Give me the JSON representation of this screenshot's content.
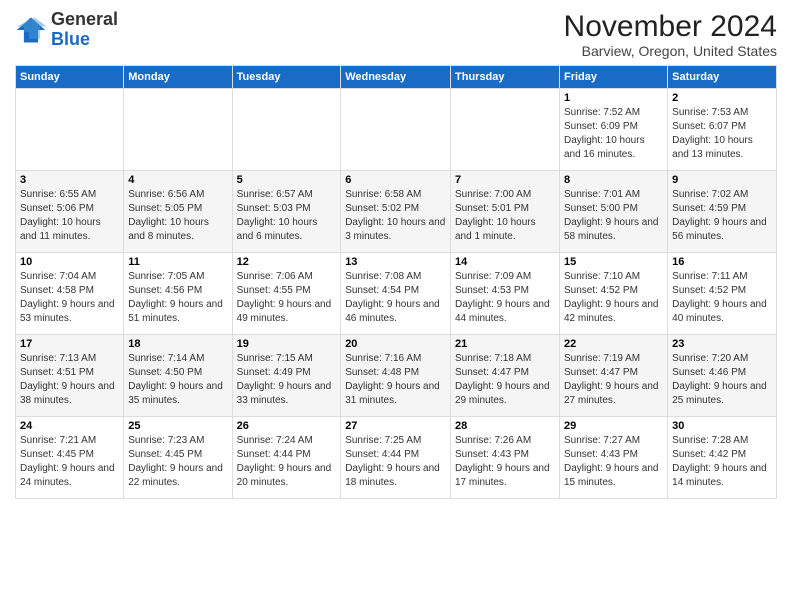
{
  "logo": {
    "general": "General",
    "blue": "Blue"
  },
  "title": "November 2024",
  "location": "Barview, Oregon, United States",
  "days_of_week": [
    "Sunday",
    "Monday",
    "Tuesday",
    "Wednesday",
    "Thursday",
    "Friday",
    "Saturday"
  ],
  "weeks": [
    [
      {
        "day": "",
        "info": ""
      },
      {
        "day": "",
        "info": ""
      },
      {
        "day": "",
        "info": ""
      },
      {
        "day": "",
        "info": ""
      },
      {
        "day": "",
        "info": ""
      },
      {
        "day": "1",
        "info": "Sunrise: 7:52 AM\nSunset: 6:09 PM\nDaylight: 10 hours and 16 minutes."
      },
      {
        "day": "2",
        "info": "Sunrise: 7:53 AM\nSunset: 6:07 PM\nDaylight: 10 hours and 13 minutes."
      }
    ],
    [
      {
        "day": "3",
        "info": "Sunrise: 6:55 AM\nSunset: 5:06 PM\nDaylight: 10 hours and 11 minutes."
      },
      {
        "day": "4",
        "info": "Sunrise: 6:56 AM\nSunset: 5:05 PM\nDaylight: 10 hours and 8 minutes."
      },
      {
        "day": "5",
        "info": "Sunrise: 6:57 AM\nSunset: 5:03 PM\nDaylight: 10 hours and 6 minutes."
      },
      {
        "day": "6",
        "info": "Sunrise: 6:58 AM\nSunset: 5:02 PM\nDaylight: 10 hours and 3 minutes."
      },
      {
        "day": "7",
        "info": "Sunrise: 7:00 AM\nSunset: 5:01 PM\nDaylight: 10 hours and 1 minute."
      },
      {
        "day": "8",
        "info": "Sunrise: 7:01 AM\nSunset: 5:00 PM\nDaylight: 9 hours and 58 minutes."
      },
      {
        "day": "9",
        "info": "Sunrise: 7:02 AM\nSunset: 4:59 PM\nDaylight: 9 hours and 56 minutes."
      }
    ],
    [
      {
        "day": "10",
        "info": "Sunrise: 7:04 AM\nSunset: 4:58 PM\nDaylight: 9 hours and 53 minutes."
      },
      {
        "day": "11",
        "info": "Sunrise: 7:05 AM\nSunset: 4:56 PM\nDaylight: 9 hours and 51 minutes."
      },
      {
        "day": "12",
        "info": "Sunrise: 7:06 AM\nSunset: 4:55 PM\nDaylight: 9 hours and 49 minutes."
      },
      {
        "day": "13",
        "info": "Sunrise: 7:08 AM\nSunset: 4:54 PM\nDaylight: 9 hours and 46 minutes."
      },
      {
        "day": "14",
        "info": "Sunrise: 7:09 AM\nSunset: 4:53 PM\nDaylight: 9 hours and 44 minutes."
      },
      {
        "day": "15",
        "info": "Sunrise: 7:10 AM\nSunset: 4:52 PM\nDaylight: 9 hours and 42 minutes."
      },
      {
        "day": "16",
        "info": "Sunrise: 7:11 AM\nSunset: 4:52 PM\nDaylight: 9 hours and 40 minutes."
      }
    ],
    [
      {
        "day": "17",
        "info": "Sunrise: 7:13 AM\nSunset: 4:51 PM\nDaylight: 9 hours and 38 minutes."
      },
      {
        "day": "18",
        "info": "Sunrise: 7:14 AM\nSunset: 4:50 PM\nDaylight: 9 hours and 35 minutes."
      },
      {
        "day": "19",
        "info": "Sunrise: 7:15 AM\nSunset: 4:49 PM\nDaylight: 9 hours and 33 minutes."
      },
      {
        "day": "20",
        "info": "Sunrise: 7:16 AM\nSunset: 4:48 PM\nDaylight: 9 hours and 31 minutes."
      },
      {
        "day": "21",
        "info": "Sunrise: 7:18 AM\nSunset: 4:47 PM\nDaylight: 9 hours and 29 minutes."
      },
      {
        "day": "22",
        "info": "Sunrise: 7:19 AM\nSunset: 4:47 PM\nDaylight: 9 hours and 27 minutes."
      },
      {
        "day": "23",
        "info": "Sunrise: 7:20 AM\nSunset: 4:46 PM\nDaylight: 9 hours and 25 minutes."
      }
    ],
    [
      {
        "day": "24",
        "info": "Sunrise: 7:21 AM\nSunset: 4:45 PM\nDaylight: 9 hours and 24 minutes."
      },
      {
        "day": "25",
        "info": "Sunrise: 7:23 AM\nSunset: 4:45 PM\nDaylight: 9 hours and 22 minutes."
      },
      {
        "day": "26",
        "info": "Sunrise: 7:24 AM\nSunset: 4:44 PM\nDaylight: 9 hours and 20 minutes."
      },
      {
        "day": "27",
        "info": "Sunrise: 7:25 AM\nSunset: 4:44 PM\nDaylight: 9 hours and 18 minutes."
      },
      {
        "day": "28",
        "info": "Sunrise: 7:26 AM\nSunset: 4:43 PM\nDaylight: 9 hours and 17 minutes."
      },
      {
        "day": "29",
        "info": "Sunrise: 7:27 AM\nSunset: 4:43 PM\nDaylight: 9 hours and 15 minutes."
      },
      {
        "day": "30",
        "info": "Sunrise: 7:28 AM\nSunset: 4:42 PM\nDaylight: 9 hours and 14 minutes."
      }
    ]
  ]
}
